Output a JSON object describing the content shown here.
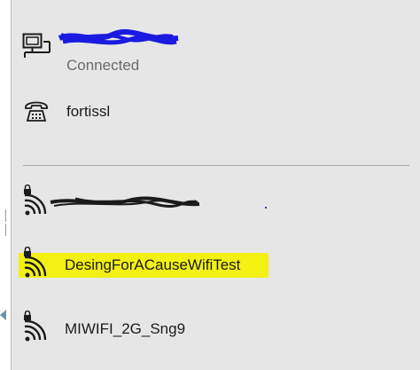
{
  "connected_network": {
    "name_redacted": true,
    "status": "Connected"
  },
  "vpn": {
    "name": "fortissl"
  },
  "wifi_networks": [
    {
      "name_redacted": true,
      "secured": true,
      "highlighted": false
    },
    {
      "name": "DesingForACauseWifiTest",
      "secured": true,
      "highlighted": true,
      "highlight_color": "#f3f014"
    },
    {
      "name": "MIWIFI_2G_Sng9",
      "secured": true,
      "highlighted": false
    }
  ],
  "icons": {
    "ethernet": "ethernet-icon",
    "vpn": "dialup-phone-icon",
    "wifi": "wifi-secured-icon"
  },
  "colors": {
    "flyout_bg": "#e6e6e6",
    "redaction": "#1a1ae0",
    "highlight": "#f3f014"
  }
}
